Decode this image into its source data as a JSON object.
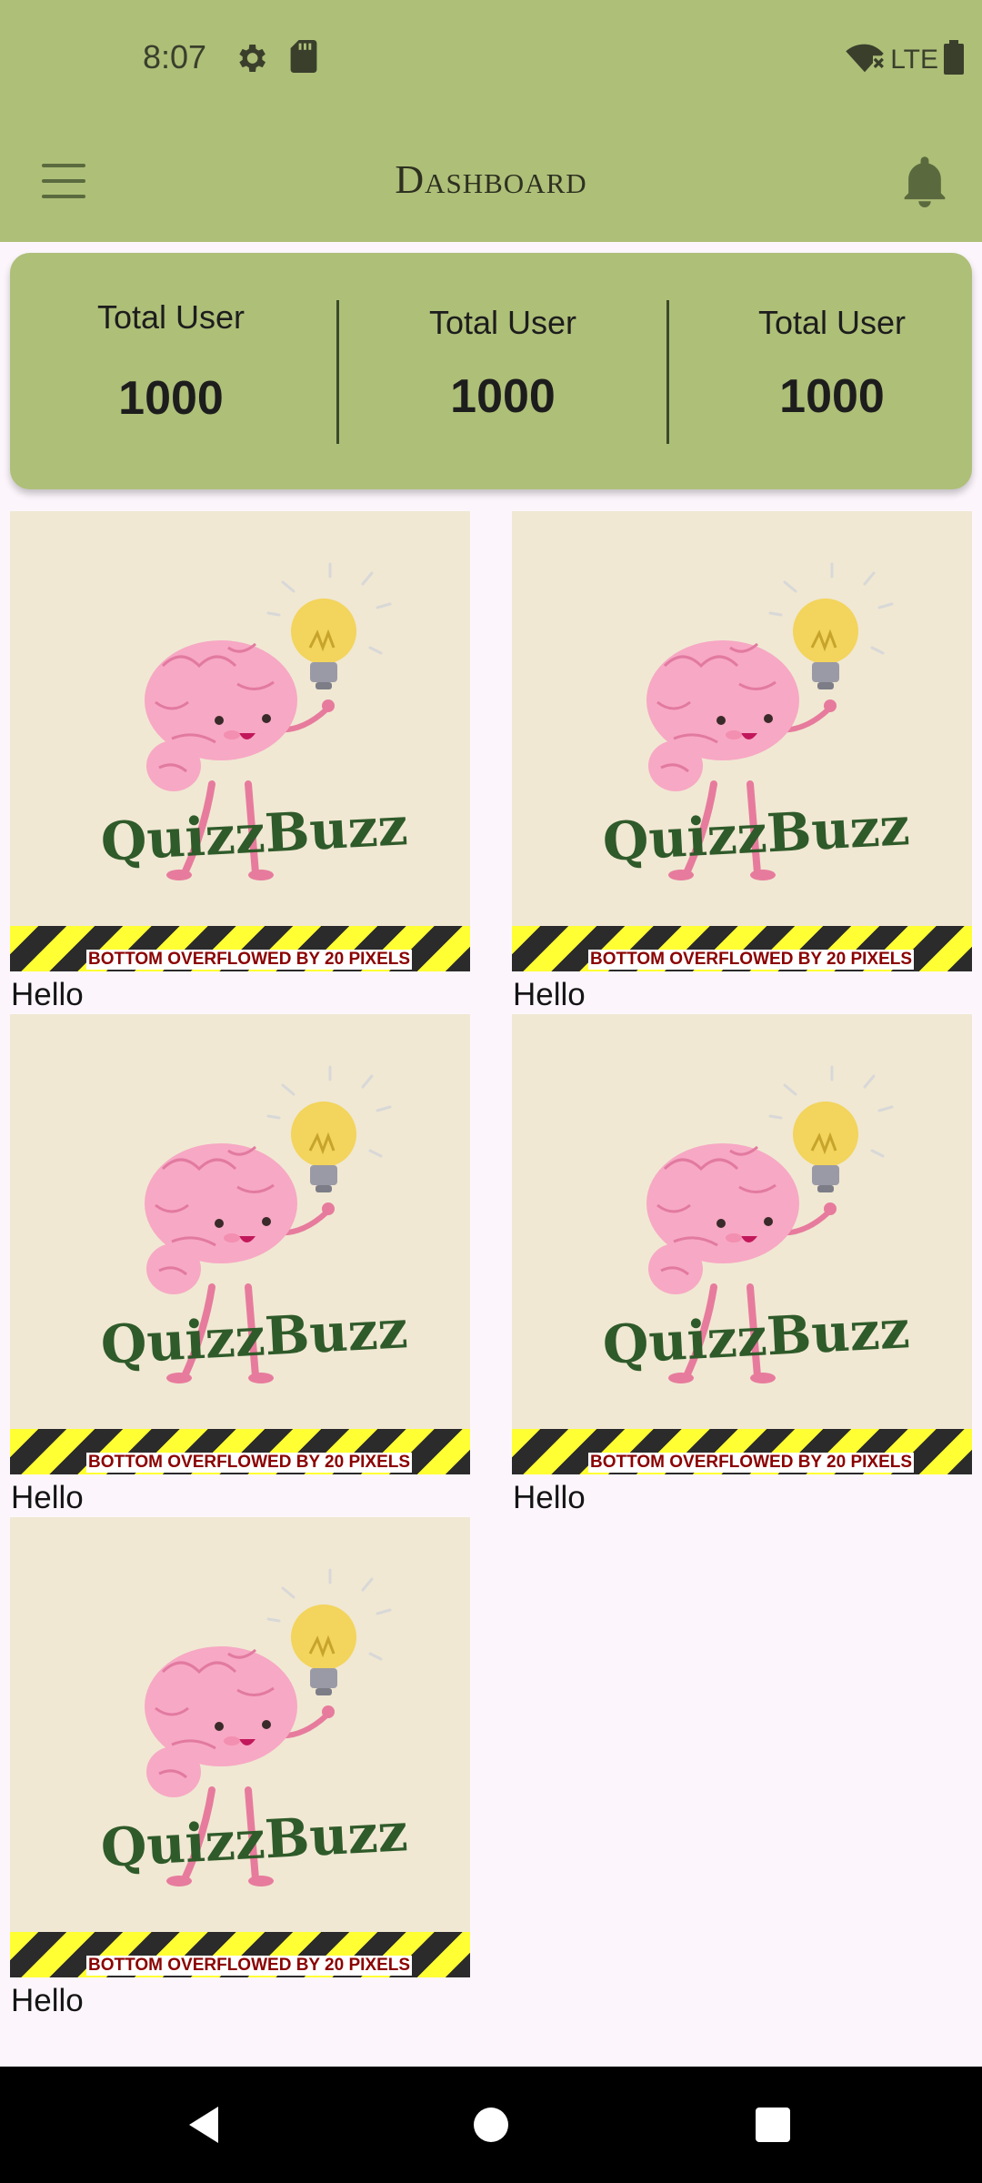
{
  "status_bar": {
    "time": "8:07",
    "network": "LTE"
  },
  "app_bar": {
    "title": "Dashboard"
  },
  "stats": [
    {
      "label": "Total User",
      "value": "1000"
    },
    {
      "label": "Total User",
      "value": "1000"
    },
    {
      "label": "Total User",
      "value": "1000"
    }
  ],
  "tiles": [
    {
      "image_text": "QuizzBuzz",
      "overflow_message": "BOTTOM OVERFLOWED BY 20 PIXELS",
      "caption": "Hello"
    },
    {
      "image_text": "QuizzBuzz",
      "overflow_message": "BOTTOM OVERFLOWED BY 20 PIXELS",
      "caption": "Hello"
    },
    {
      "image_text": "QuizzBuzz",
      "overflow_message": "BOTTOM OVERFLOWED BY 20 PIXELS",
      "caption": "Hello"
    },
    {
      "image_text": "QuizzBuzz",
      "overflow_message": "BOTTOM OVERFLOWED BY 20 PIXELS",
      "caption": "Hello"
    },
    {
      "image_text": "QuizzBuzz",
      "overflow_message": "BOTTOM OVERFLOWED BY 20 PIXELS",
      "caption": "Hello"
    }
  ],
  "icons": {
    "status": [
      "settings-icon",
      "sd-card-icon",
      "wifi-off-icon",
      "battery-icon"
    ],
    "app_bar": [
      "menu-icon",
      "bell-icon"
    ],
    "nav": [
      "back-icon",
      "home-icon",
      "recents-icon"
    ]
  },
  "colors": {
    "app_bar": "#aebf78",
    "card": "#aebf78",
    "tile_background": "#f0e8d3",
    "logo_text": "#2f5a2a",
    "page_background": "#fcf6fc"
  }
}
